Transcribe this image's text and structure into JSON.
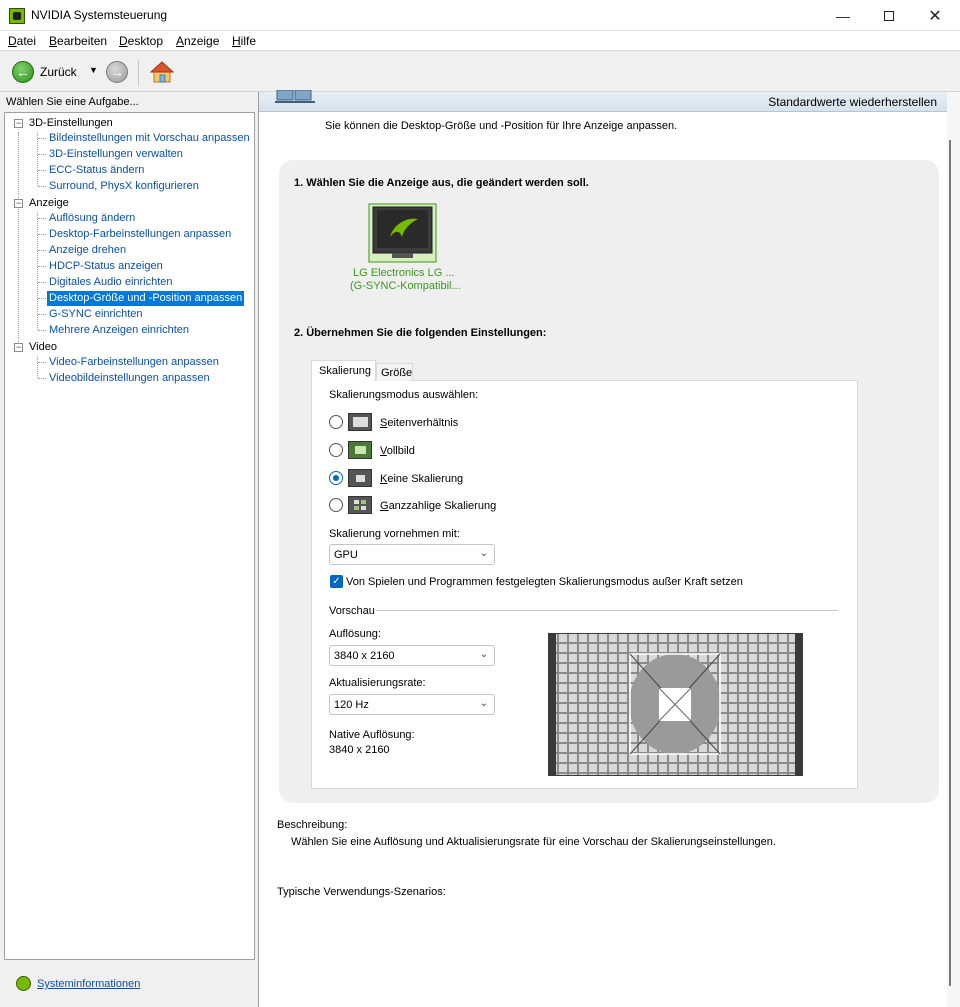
{
  "window": {
    "title": "NVIDIA Systemsteuerung"
  },
  "menu": [
    "Datei",
    "Bearbeiten",
    "Desktop",
    "Anzeige",
    "Hilfe"
  ],
  "toolbar": {
    "back_label": "Zurück"
  },
  "left": {
    "header": "Wählen Sie eine Aufgabe...",
    "categories": [
      {
        "label": "3D-Einstellungen",
        "items": [
          "Bildeinstellungen mit Vorschau anpassen",
          "3D-Einstellungen verwalten",
          "ECC-Status ändern",
          "Surround, PhysX konfigurieren"
        ]
      },
      {
        "label": "Anzeige",
        "items": [
          "Auflösung ändern",
          "Desktop-Farbeinstellungen anpassen",
          "Anzeige drehen",
          "HDCP-Status anzeigen",
          "Digitales Audio einrichten",
          "Desktop-Größe und -Position anpassen",
          "G-SYNC einrichten",
          "Mehrere Anzeigen einrichten"
        ]
      },
      {
        "label": "Video",
        "items": [
          "Video-Farbeinstellungen anpassen",
          "Videobildeinstellungen anpassen"
        ]
      }
    ],
    "selected_item": "Desktop-Größe und -Position anpassen",
    "sysinfo_link": "Systeminformationen"
  },
  "right": {
    "restore_link": "Standardwerte wiederherstellen",
    "intro": "Sie können die Desktop-Größe und -Position für Ihre Anzeige anpassen.",
    "step1": "1. Wählen Sie die Anzeige aus, die geändert werden soll.",
    "monitor": {
      "line1": "LG Electronics LG ...",
      "line2": "(G-SYNC-Kompatibil..."
    },
    "step2": "2. Übernehmen Sie die folgenden Einstellungen:",
    "tabs": [
      "Skalierung",
      "Größe"
    ],
    "mode_label": "Skalierungsmodus auswählen:",
    "modes": [
      {
        "label": "Seitenverhältnis",
        "checked": false
      },
      {
        "label": "Vollbild",
        "checked": false
      },
      {
        "label": "Keine Skalierung",
        "checked": true
      },
      {
        "label": "Ganzzahlige Skalierung",
        "checked": false
      }
    ],
    "scale_with_label": "Skalierung vornehmen mit:",
    "scale_with_value": "GPU",
    "override_label": "Von Spielen und Programmen festgelegten Skalierungsmodus außer Kraft setzen",
    "override_checked": true,
    "preview_label": "Vorschau",
    "resolution_label": "Auflösung:",
    "resolution_value": "3840 x 2160",
    "refresh_label": "Aktualisierungsrate:",
    "refresh_value": "120 Hz",
    "native_label": "Native Auflösung:",
    "native_value": "3840 x 2160",
    "description_label": "Beschreibung:",
    "description_text": "Wählen Sie eine Auflösung und Aktualisierungsrate für eine Vorschau der Skalierungseinstellungen.",
    "usage_label": "Typische Verwendungs-Szenarios:"
  },
  "colors": {
    "accent": "#0067c0",
    "nvidia_green": "#76b900",
    "link": "#0b4fa8",
    "selection": "#0078d7"
  }
}
